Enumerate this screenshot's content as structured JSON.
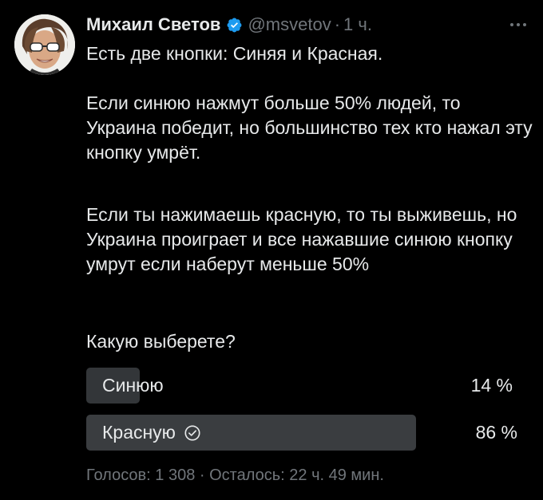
{
  "author": {
    "name": "Михаил Светов",
    "handle": "@msvetov",
    "time": "1 ч."
  },
  "tweet": {
    "paragraph1": "Есть две кнопки: Синяя и Красная.",
    "paragraph2": "Если синюю нажмут больше 50% людей, то Украина победит, но большинство тех кто нажал эту кнопку умрёт.",
    "paragraph3": "Если ты нажимаешь красную, то ты выживешь, но Украина проиграет и все нажавшие синюю кнопку умрут если наберут меньше 50%",
    "paragraph4": "Какую выберете?"
  },
  "poll": {
    "options": [
      {
        "label": "Синюю",
        "percent_text": "14 %",
        "share": 0.14,
        "selected": false
      },
      {
        "label": "Красную",
        "percent_text": "86 %",
        "share": 0.86,
        "selected": true
      }
    ],
    "votes": "Голосов: 1 308",
    "remaining": "Осталось: 22 ч. 49 мин."
  },
  "icons": {
    "verified": "verified-badge-icon",
    "more": "more-options-icon",
    "selected": "check-circle-icon"
  },
  "colors": {
    "background": "#000000",
    "text": "#e7e9ea",
    "muted": "#71767b",
    "verified_blue": "#1d9bf0",
    "bar": "#333639"
  }
}
